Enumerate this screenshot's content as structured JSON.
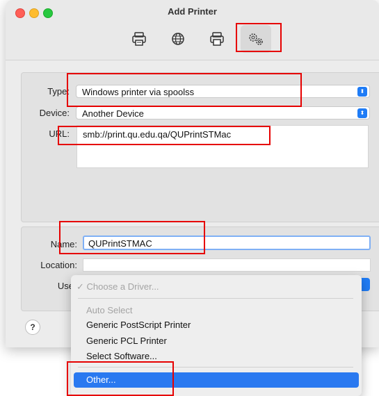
{
  "window": {
    "title": "Add Printer"
  },
  "toolbar": {
    "buttons": [
      {
        "icon": "default-printer-icon"
      },
      {
        "icon": "ip-globe-icon"
      },
      {
        "icon": "windows-printer-icon"
      },
      {
        "icon": "advanced-gears-icon",
        "selected": true
      }
    ]
  },
  "form": {
    "type_label": "Type:",
    "type_value": "Windows printer via spoolss",
    "device_label": "Device:",
    "device_value": "Another Device",
    "url_label": "URL:",
    "url_value": "smb://print.qu.edu.qa/QUPrintSTMac",
    "name_label": "Name:",
    "name_value": "QUPrintSTMAC",
    "location_label": "Location:",
    "location_value": "",
    "use_label": "Use"
  },
  "driver_menu": {
    "items": [
      {
        "label": "✓ Choose a Driver...",
        "disabled": true
      },
      {
        "label": "Auto Select",
        "disabled": true
      },
      {
        "label": "Generic PostScript Printer",
        "disabled": false
      },
      {
        "label": "Generic PCL Printer",
        "disabled": false
      },
      {
        "label": "Select Software...",
        "disabled": false
      },
      {
        "label": "Other...",
        "highlighted": true
      }
    ]
  },
  "help": {
    "label": "?"
  },
  "colors": {
    "accent": "#2a79f0",
    "annotation": "#e60000"
  }
}
